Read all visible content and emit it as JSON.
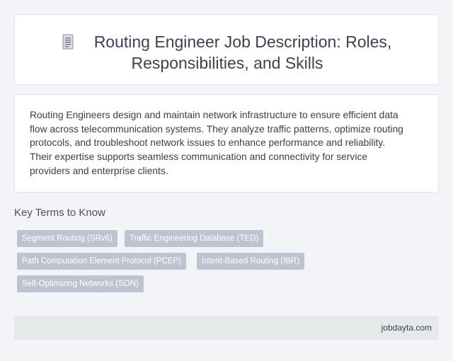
{
  "header": {
    "icon": "document-icon",
    "title_line1": "Routing Engineer Job Description: Roles,",
    "title_line2": "Responsibilities, and Skills"
  },
  "description": {
    "lines": [
      "Routing Engineers design and maintain network infrastructure to ensure efficient data",
      "flow across telecommunication systems. They analyze traffic patterns, optimize routing",
      "protocols, and troubleshoot network issues to enhance performance and reliability.",
      "Their expertise supports seamless communication and connectivity for service",
      "providers and enterprise clients."
    ]
  },
  "key_terms": {
    "heading": "Key Terms to Know",
    "tags": [
      "Segment Routing (SRv6)",
      "Traffic Engineering Database (TED)",
      "Path Computation Element Protocol (PCEP)",
      "Intent-Based Routing (IBR)",
      "Self-Optimizing Networks (SON)"
    ]
  },
  "footer": {
    "site": "jobdayta.com"
  },
  "colors": {
    "background": "#f3f4f7",
    "card": "#ffffff",
    "tag_background": "#bfc3d1",
    "footer_background": "#e5e9ea",
    "title_text": "#3d4150"
  }
}
